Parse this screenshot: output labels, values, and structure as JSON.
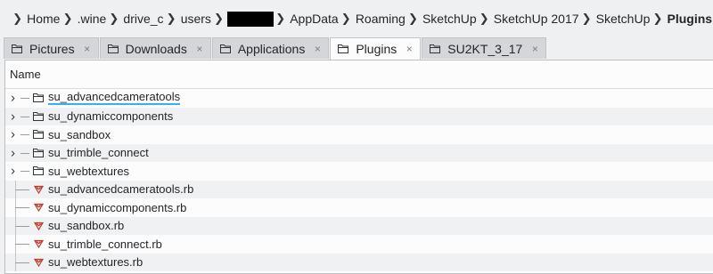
{
  "breadcrumb": {
    "items": [
      {
        "label": "Home"
      },
      {
        "label": ".wine"
      },
      {
        "label": "drive_c"
      },
      {
        "label": "users"
      },
      {
        "label": ""
      },
      {
        "label": "AppData"
      },
      {
        "label": "Roaming"
      },
      {
        "label": "SketchUp"
      },
      {
        "label": "SketchUp 2017"
      },
      {
        "label": "SketchUp"
      },
      {
        "label": "Plugins"
      }
    ]
  },
  "tabs": [
    {
      "label": "Pictures",
      "icon": "folder-icon",
      "close": "×",
      "active": false
    },
    {
      "label": "Downloads",
      "icon": "folder-icon",
      "close": "×",
      "active": false
    },
    {
      "label": "Applications",
      "icon": "folder-icon",
      "close": "×",
      "active": false
    },
    {
      "label": "Plugins",
      "icon": "folder-icon",
      "close": "×",
      "active": true
    },
    {
      "label": "SU2KT_3_17",
      "icon": "folder-icon",
      "close": "×",
      "active": false
    }
  ],
  "list": {
    "column_header": "Name",
    "rows": [
      {
        "name": "su_advancedcameratools",
        "type": "folder",
        "icon": "folder-icon"
      },
      {
        "name": "su_dynamiccomponents",
        "type": "folder",
        "icon": "folder-icon"
      },
      {
        "name": "su_sandbox",
        "type": "folder",
        "icon": "folder-icon"
      },
      {
        "name": "su_trimble_connect",
        "type": "folder",
        "icon": "folder-icon"
      },
      {
        "name": "su_webtextures",
        "type": "folder",
        "icon": "folder-icon"
      },
      {
        "name": "su_advancedcameratools.rb",
        "type": "ruby",
        "icon": "ruby-file-icon"
      },
      {
        "name": "su_dynamiccomponents.rb",
        "type": "ruby",
        "icon": "ruby-file-icon"
      },
      {
        "name": "su_sandbox.rb",
        "type": "ruby",
        "icon": "ruby-file-icon"
      },
      {
        "name": "su_trimble_connect.rb",
        "type": "ruby",
        "icon": "ruby-file-icon"
      },
      {
        "name": "su_webtextures.rb",
        "type": "ruby",
        "icon": "ruby-file-icon"
      }
    ]
  },
  "colors": {
    "accent": "#3daee9",
    "ruby": "#c0392b"
  }
}
